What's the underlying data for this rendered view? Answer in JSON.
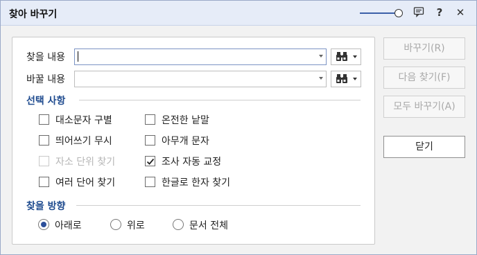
{
  "window": {
    "title": "찾아 바꾸기"
  },
  "titlebar": {
    "icons": [
      "zoom-slider",
      "comment-icon",
      "help-icon",
      "close-icon"
    ],
    "help": "?",
    "close": "✕"
  },
  "find": {
    "label": "찾을 내용",
    "value": ""
  },
  "replace": {
    "label": "바꿀 내용",
    "value": ""
  },
  "options": {
    "title": "선택 사항",
    "items": [
      {
        "label": "대소문자 구별",
        "checked": false,
        "enabled": true
      },
      {
        "label": "온전한 낱말",
        "checked": false,
        "enabled": true
      },
      {
        "label": "띄어쓰기 무시",
        "checked": false,
        "enabled": true
      },
      {
        "label": "아무개 문자",
        "checked": false,
        "enabled": true
      },
      {
        "label": "자소 단위 찾기",
        "checked": false,
        "enabled": false
      },
      {
        "label": "조사 자동 교정",
        "checked": true,
        "enabled": true
      },
      {
        "label": "여러 단어 찾기",
        "checked": false,
        "enabled": true
      },
      {
        "label": "한글로 한자 찾기",
        "checked": false,
        "enabled": true
      }
    ]
  },
  "direction": {
    "title": "찾을 방향",
    "options": [
      {
        "label": "아래로",
        "selected": true
      },
      {
        "label": "위로",
        "selected": false
      },
      {
        "label": "문서 전체",
        "selected": false
      }
    ]
  },
  "buttons": {
    "replace": "바꾸기(R)",
    "find_next": "다음 찾기(F)",
    "replace_all": "모두 바꾸기(A)",
    "close": "닫기"
  },
  "colors": {
    "accent": "#1f4b8f",
    "titlebar": "#e6ecf8",
    "disabled_text": "#a9a9a9"
  }
}
